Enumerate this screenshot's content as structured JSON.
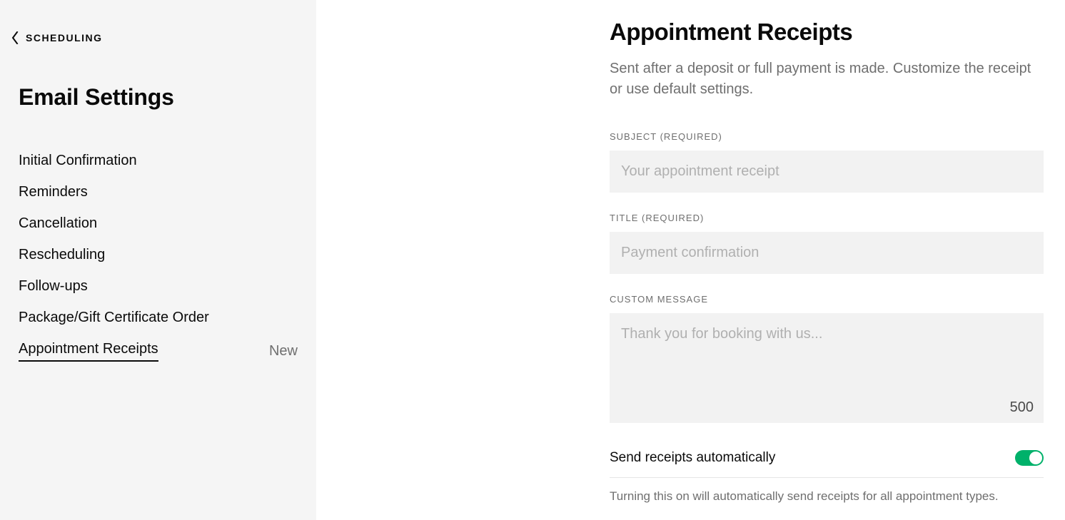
{
  "sidebar": {
    "back_label": "SCHEDULING",
    "title": "Email Settings",
    "items": [
      {
        "label": "Initial Confirmation",
        "badge": "",
        "active": false
      },
      {
        "label": "Reminders",
        "badge": "",
        "active": false
      },
      {
        "label": "Cancellation",
        "badge": "",
        "active": false
      },
      {
        "label": "Rescheduling",
        "badge": "",
        "active": false
      },
      {
        "label": "Follow-ups",
        "badge": "",
        "active": false
      },
      {
        "label": "Package/Gift Certificate Order",
        "badge": "",
        "active": false
      },
      {
        "label": "Appointment Receipts",
        "badge": "New",
        "active": true
      }
    ]
  },
  "main": {
    "title": "Appointment Receipts",
    "description": "Sent after a deposit or full payment is made. Customize the receipt or use default settings.",
    "subject": {
      "label": "SUBJECT (REQUIRED)",
      "placeholder": "Your appointment receipt",
      "value": ""
    },
    "title_field": {
      "label": "TITLE (REQUIRED)",
      "placeholder": "Payment confirmation",
      "value": ""
    },
    "custom_message": {
      "label": "CUSTOM MESSAGE",
      "placeholder": "Thank you for booking with us...",
      "value": "",
      "char_remaining": "500"
    },
    "toggle": {
      "label": "Send receipts automatically",
      "on": true,
      "helper": "Turning this on will automatically send receipts for all appointment types."
    }
  }
}
